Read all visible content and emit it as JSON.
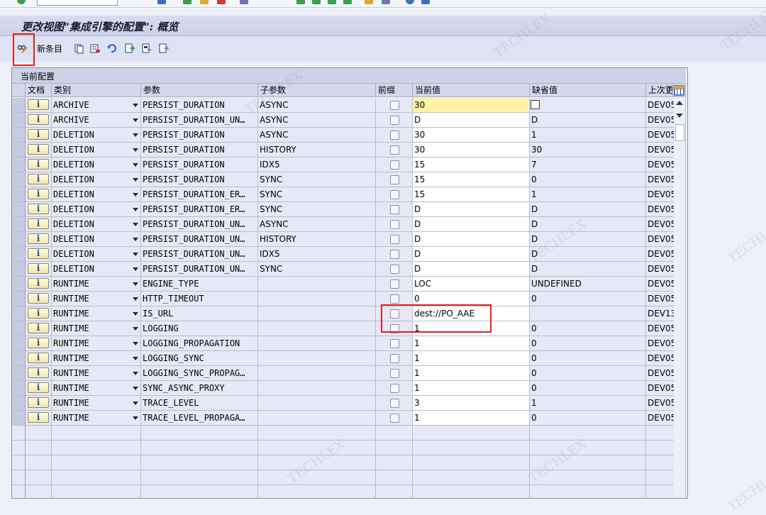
{
  "window": {
    "title": "更改视图\"集成引擎的配置\": 概览"
  },
  "toolbar": {
    "new_entry_label": "新条目"
  },
  "panel": {
    "title": "当前配置"
  },
  "table": {
    "columns": [
      "文档",
      "类别",
      "参数",
      "子参数",
      "前缀",
      "当前值",
      "缺省值",
      "上次更"
    ],
    "rows": [
      {
        "category": "ARCHIVE",
        "param": "PERSIST_DURATION",
        "subparam": "ASYNC",
        "current": "30",
        "default": "",
        "last": "DEV05"
      },
      {
        "category": "ARCHIVE",
        "param": "PERSIST_DURATION_UN…",
        "subparam": "ASYNC",
        "current": "D",
        "default": "D",
        "last": "DEV05"
      },
      {
        "category": "DELETION",
        "param": "PERSIST_DURATION",
        "subparam": "ASYNC",
        "current": "30",
        "default": "1",
        "last": "DEV05"
      },
      {
        "category": "DELETION",
        "param": "PERSIST_DURATION",
        "subparam": "HISTORY",
        "current": "30",
        "default": "30",
        "last": "DEV05"
      },
      {
        "category": "DELETION",
        "param": "PERSIST_DURATION",
        "subparam": "IDX5",
        "current": "15",
        "default": "7",
        "last": "DEV05"
      },
      {
        "category": "DELETION",
        "param": "PERSIST_DURATION",
        "subparam": "SYNC",
        "current": "15",
        "default": "0",
        "last": "DEV05"
      },
      {
        "category": "DELETION",
        "param": "PERSIST_DURATION_ER…",
        "subparam": "SYNC",
        "current": "15",
        "default": "1",
        "last": "DEV05"
      },
      {
        "category": "DELETION",
        "param": "PERSIST_DURATION_ER…",
        "subparam": "SYNC",
        "current": "D",
        "default": "D",
        "last": "DEV05"
      },
      {
        "category": "DELETION",
        "param": "PERSIST_DURATION_UN…",
        "subparam": "ASYNC",
        "current": "D",
        "default": "D",
        "last": "DEV05"
      },
      {
        "category": "DELETION",
        "param": "PERSIST_DURATION_UN…",
        "subparam": "HISTORY",
        "current": "D",
        "default": "D",
        "last": "DEV05"
      },
      {
        "category": "DELETION",
        "param": "PERSIST_DURATION_UN…",
        "subparam": "IDX5",
        "current": "D",
        "default": "D",
        "last": "DEV05"
      },
      {
        "category": "DELETION",
        "param": "PERSIST_DURATION_UN…",
        "subparam": "SYNC",
        "current": "D",
        "default": "D",
        "last": "DEV05"
      },
      {
        "category": "RUNTIME",
        "param": "ENGINE_TYPE",
        "subparam": "",
        "current": "LOC",
        "default": "UNDEFINED",
        "last": "DEV05"
      },
      {
        "category": "RUNTIME",
        "param": "HTTP_TIMEOUT",
        "subparam": "",
        "current": "0",
        "default": "0",
        "last": "DEV05"
      },
      {
        "category": "RUNTIME",
        "param": "IS_URL",
        "subparam": "",
        "current": "dest://PO_AAE",
        "default": "",
        "last": "DEV13"
      },
      {
        "category": "RUNTIME",
        "param": "LOGGING",
        "subparam": "",
        "current": "1",
        "default": "0",
        "last": "DEV05"
      },
      {
        "category": "RUNTIME",
        "param": "LOGGING_PROPAGATION",
        "subparam": "",
        "current": "1",
        "default": "0",
        "last": "DEV05"
      },
      {
        "category": "RUNTIME",
        "param": "LOGGING_SYNC",
        "subparam": "",
        "current": "1",
        "default": "0",
        "last": "DEV05"
      },
      {
        "category": "RUNTIME",
        "param": "LOGGING_SYNC_PROPAG…",
        "subparam": "",
        "current": "1",
        "default": "0",
        "last": "DEV05"
      },
      {
        "category": "RUNTIME",
        "param": "SYNC_ASYNC_PROXY",
        "subparam": "",
        "current": "1",
        "default": "0",
        "last": "DEV05"
      },
      {
        "category": "RUNTIME",
        "param": "TRACE_LEVEL",
        "subparam": "",
        "current": "3",
        "default": "1",
        "last": "DEV05"
      },
      {
        "category": "RUNTIME",
        "param": "TRACE_LEVEL_PROPAGA…",
        "subparam": "",
        "current": "1",
        "default": "0",
        "last": "DEV05"
      }
    ],
    "empty_rows": 5
  },
  "watermarks": [
    "TECHLEX",
    "TECHLEX",
    "TECHLEX",
    "TECHLEX",
    "TECHLEX",
    "TECHLEX",
    "TECHLEX",
    "TECHLEX"
  ],
  "colors": {
    "highlight": "#e51d1d",
    "focus_cell": "#fff3a8",
    "info_button": "#1d4fb5"
  }
}
